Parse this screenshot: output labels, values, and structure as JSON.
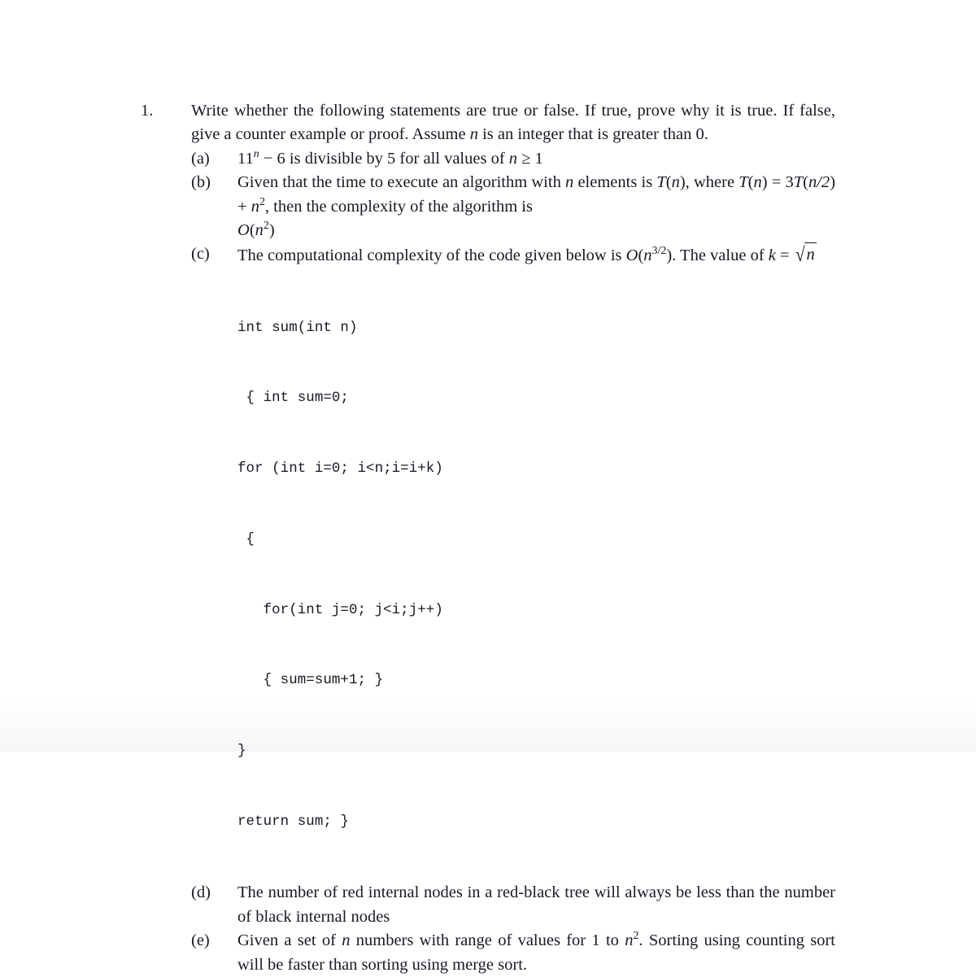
{
  "document": {
    "page_background": "#ffffff",
    "text_color": "#171a24"
  },
  "question": {
    "number": "1.",
    "stem": "Write whether the following statements are true or false. If true, prove why it is true. If false, give a counter example or proof. Assume n is an integer that is greater than 0.",
    "stem_parts": {
      "p1": "Write whether the following statements are true or false. If true, prove why it is true. If false, give a counter example or proof. Assume ",
      "var_n": "n",
      "p2": " is an integer that is greater than 0."
    },
    "sub_items": [
      {
        "label": "(a)",
        "text": "11n − 6 is divisible by 5 for all values of n ≥ 1",
        "parts": {
          "base": "11",
          "exp": "n",
          "after_exp": " − 6 is divisible by 5 for all values of ",
          "var_n": "n",
          "relation": " ≥ 1"
        }
      },
      {
        "label": "(b)",
        "text": "Given that the time to execute an algorithm with n elements is T(n), where T(n) = 3T(n/2) + n2, then the complexity of the algorithm is O(n2)",
        "parts": {
          "s1": "Given that the time to execute an algorithm with ",
          "var_n1": "n",
          "s2": " elements is ",
          "T": "T",
          "paren_open": "(",
          "var_n2": "n",
          "paren_close": ")",
          "s3": ", where ",
          "eq_T": "T",
          "eq_n": "n",
          "eq_mid": " = 3",
          "eq_T2": "T",
          "eq_arg": "n/2",
          "eq_plus": " + ",
          "eq_nsq_base": "n",
          "eq_nsq_exp": "2",
          "s4": ", then the complexity of the algorithm is",
          "big_o": "O",
          "big_o_arg_base": "n",
          "big_o_arg_exp": "2"
        }
      },
      {
        "label": "(c)",
        "text": "The computational complexity of the code given below is O(n3/2). The value of k = √n",
        "parts": {
          "s1": "The computational complexity of the code given below is ",
          "big_o": "O",
          "big_o_arg_base": "n",
          "big_o_arg_exp": "3/2",
          "s2": ". The value of ",
          "var_k": "k",
          "equals": " = ",
          "sqrt_radicand": "n"
        },
        "code": {
          "language": "c",
          "lines": [
            "int sum(int n)",
            " { int sum=0;",
            "for (int i=0; i<n;i=i+k)",
            " {",
            "   for(int j=0; j<i;j++)",
            "   { sum=sum+1; }",
            "}",
            "return sum; }"
          ]
        }
      },
      {
        "label": "(d)",
        "text": "The number of red internal nodes in a red-black tree will always be less than the number of black internal nodes"
      },
      {
        "label": "(e)",
        "text": "Given a set of n numbers with range of values for 1 to n2. Sorting using counting sort will be faster than sorting using merge sort.",
        "parts": {
          "s1": "Given a set of ",
          "var_n": "n",
          "s2": " numbers with range of values for 1 to ",
          "nsq_base": "n",
          "nsq_exp": "2",
          "s3": ". Sorting using counting sort will be faster than sorting using merge sort."
        }
      }
    ]
  }
}
